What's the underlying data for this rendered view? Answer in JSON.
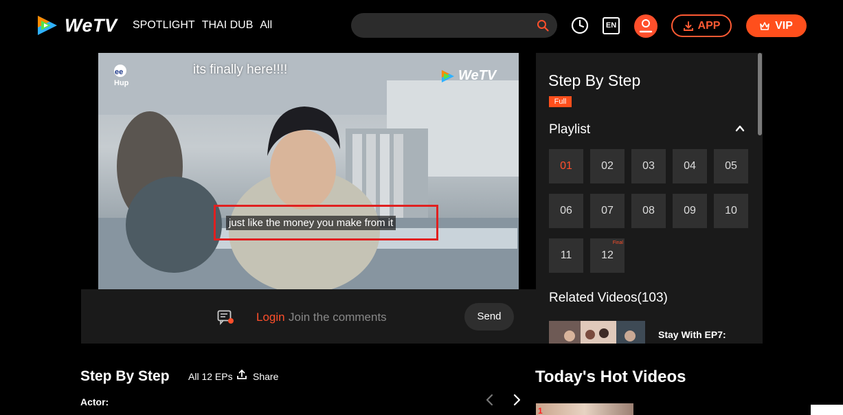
{
  "header": {
    "brand": "WeTV",
    "nav": [
      "SPOTLIGHT",
      "THAI DUB",
      "All"
    ],
    "search": {
      "value": "",
      "icon": "search-icon"
    },
    "history_icon": "clock-icon",
    "lang": "EN",
    "account_icon": "user-icon",
    "app_label": "APP",
    "vip_label": "VIP",
    "accent_color": "#ff4f2b"
  },
  "player": {
    "top_caption": "its finally here!!!!",
    "subtitle": "just like the money you make from it",
    "watermark": "WeTV"
  },
  "comments": {
    "login_label": "Login",
    "placeholder": "Join the comments",
    "send_label": "Send"
  },
  "side": {
    "title": "Step By Step",
    "status_tag": "Full",
    "playlist_label": "Playlist",
    "episodes": [
      {
        "label": "01",
        "active": true
      },
      {
        "label": "02"
      },
      {
        "label": "03"
      },
      {
        "label": "04"
      },
      {
        "label": "05"
      },
      {
        "label": "06"
      },
      {
        "label": "07"
      },
      {
        "label": "08"
      },
      {
        "label": "09"
      },
      {
        "label": "10"
      },
      {
        "label": "11"
      },
      {
        "label": "12",
        "tag": "Final"
      }
    ],
    "related_title": "Related Videos(103)",
    "related_items": [
      {
        "title": "Stay With EP7:"
      }
    ]
  },
  "info": {
    "title": "Step By Step",
    "episode_count": "All 12 EPs",
    "share_label": "Share",
    "actor_label": "Actor:"
  },
  "hot": {
    "title": "Today's Hot Videos",
    "first_rank": "1"
  }
}
